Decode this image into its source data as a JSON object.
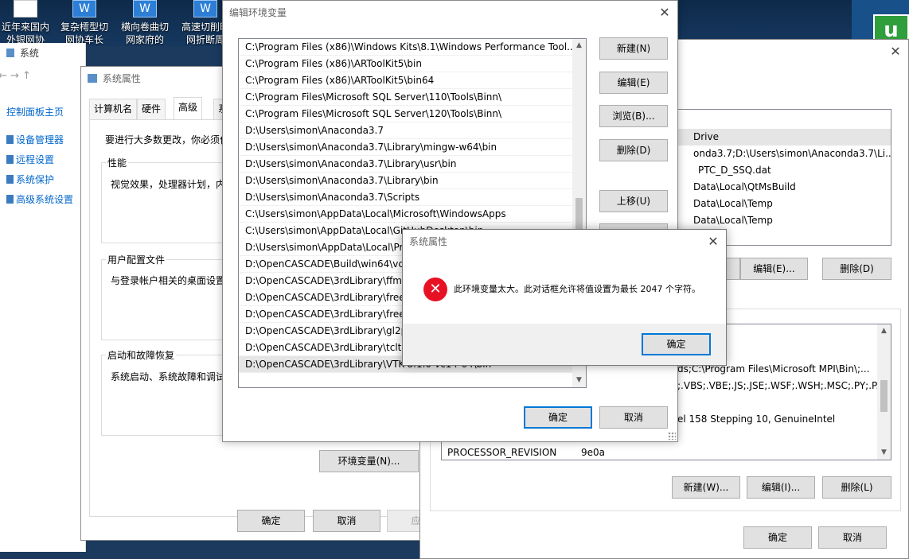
{
  "desktop": {
    "icons": [
      {
        "line1": "近年来国内",
        "line2": "外银网协"
      },
      {
        "line1": "复杂樗型切",
        "line2": "网协车长"
      },
      {
        "line1": "横向卷曲切",
        "line2": "网家府的"
      },
      {
        "line1": "高速切削时",
        "line2": "网折断周"
      }
    ]
  },
  "system_window": {
    "title": "系统",
    "nav": "← → ↑",
    "sidebar": [
      "控制面板主页",
      "设备管理器",
      "远程设置",
      "系统保护",
      "高级系统设置"
    ]
  },
  "system_properties": {
    "title": "系统属性",
    "tabs": [
      "计算机名",
      "硬件",
      "高级",
      "系"
    ],
    "intro": "要进行大多数更改，你必须作",
    "groups": [
      {
        "label": "性能",
        "text": "视觉效果，处理器计划，内"
      },
      {
        "label": "用户配置文件",
        "text": "与登录帐户相关的桌面设置"
      },
      {
        "label": "启动和故障恢复",
        "text": "系统启动、系统故障和调试"
      }
    ],
    "env_button": "环境变量(N)...",
    "ok": "确定",
    "cancel": "取消",
    "apply": "应用"
  },
  "env_vars": {
    "user_list_rows": [
      "Drive",
      "onda3.7;D:\\Users\\simon\\Anaconda3.7\\Li...",
      "PTC_D_SSQ.dat",
      "Data\\Local\\QtMsBuild",
      "Data\\Local\\Temp",
      "Data\\Local\\Temp"
    ],
    "user_edit": "编辑(E)...",
    "user_delete": "删除(D)",
    "system_list_rows": [
      "ds;C:\\Program Files\\Microsoft MPI\\Bin\\;...",
      ";.VBS;.VBE;.JS;.JSE;.WSF;.WSH;.MSC;.PY;.P...",
      "el 158 Stepping 10, GenuineIntel"
    ],
    "proc_name": "PROCESSOR_REVISION",
    "proc_value": "9e0a",
    "sys_new": "新建(W)...",
    "sys_edit": "编辑(I)...",
    "sys_delete": "删除(L)",
    "ok": "确定",
    "cancel": "取消"
  },
  "edit_dialog": {
    "title": "编辑环境变量",
    "paths": [
      "C:\\Program Files (x86)\\Windows Kits\\8.1\\Windows Performance Tool...",
      "C:\\Program Files (x86)\\ARToolKit5\\bin",
      "C:\\Program Files (x86)\\ARToolKit5\\bin64",
      "C:\\Program Files\\Microsoft SQL Server\\110\\Tools\\Binn\\",
      "C:\\Program Files\\Microsoft SQL Server\\120\\Tools\\Binn\\",
      "D:\\Users\\simon\\Anaconda3.7",
      "D:\\Users\\simon\\Anaconda3.7\\Library\\mingw-w64\\bin",
      "D:\\Users\\simon\\Anaconda3.7\\Library\\usr\\bin",
      "D:\\Users\\simon\\Anaconda3.7\\Library\\bin",
      "D:\\Users\\simon\\Anaconda3.7\\Scripts",
      "C:\\Users\\simon\\AppData\\Local\\Microsoft\\WindowsApps",
      "C:\\Users\\simon\\AppData\\Local\\GitHubDesktop\\bin",
      "D:\\Users\\simon\\AppData\\Local\\Pr",
      "D:\\OpenCASCADE\\Build\\win64\\vc1",
      "D:\\OpenCASCADE\\3rdLibrary\\ffmp",
      "D:\\OpenCASCADE\\3rdLibrary\\freei",
      "D:\\OpenCASCADE\\3rdLibrary\\freet",
      "D:\\OpenCASCADE\\3rdLibrary\\gl2p",
      "D:\\OpenCASCADE\\3rdLibrary\\tcltk",
      "D:\\OpenCASCADE\\3rdLibrary\\VTK-8.1.0-vc14-64\\bin"
    ],
    "buttons": {
      "new": "新建(N)",
      "edit": "编辑(E)",
      "browse": "浏览(B)...",
      "delete": "删除(D)",
      "move_up": "上移(U)"
    },
    "ok": "确定",
    "cancel": "取消"
  },
  "message_box": {
    "title": "系统属性",
    "message": "此环境变量太大。此对话框允许将值设置为最长 2047 个字符。",
    "ok": "确定",
    "icon": "error-icon"
  }
}
